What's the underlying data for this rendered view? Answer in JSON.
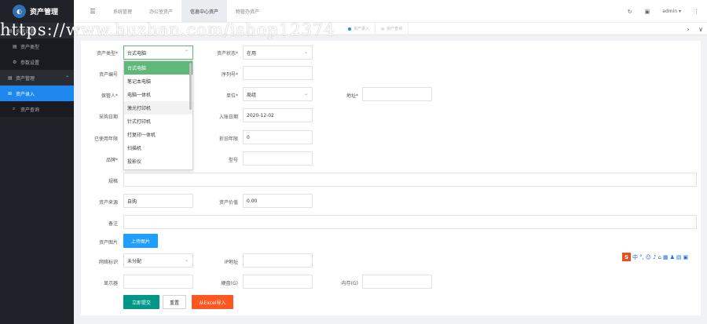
{
  "app": {
    "title": "资产管理"
  },
  "sidebar": {
    "items": [
      {
        "label": "系统设置",
        "icon": "grid-icon",
        "kind": "group"
      },
      {
        "label": "资产类型",
        "icon": "grid-icon",
        "kind": "sub"
      },
      {
        "label": "参数设置",
        "icon": "gear-icon",
        "kind": "sub"
      },
      {
        "label": "资产管理",
        "icon": "grid-icon",
        "kind": "group"
      },
      {
        "label": "资产录入",
        "icon": "plus-square-icon",
        "kind": "active"
      },
      {
        "label": "资产查询",
        "icon": "search-icon",
        "kind": "sub"
      }
    ]
  },
  "header": {
    "menu_icon": "☰",
    "nav": [
      "系统管理",
      "办公室资产",
      "信息中心资产",
      "物管办资产"
    ],
    "active_nav": 2,
    "refresh_icon": "↻",
    "theme_icon": "▣",
    "user": "admin ▾",
    "more_icon": "⋮"
  },
  "tabbar": {
    "tabs": [
      "资产录入",
      "资产查询"
    ],
    "nav_right": "›",
    "nav_down": "∨"
  },
  "watermark": "https://www.huzhan.com/ishop12374",
  "form": {
    "asset_type": {
      "label": "资产类型*",
      "value": "台式电脑"
    },
    "asset_status": {
      "label": "资产状态*",
      "value": "在用"
    },
    "asset_no": {
      "label": "资产编号"
    },
    "serial_no": {
      "label": "序列号*"
    },
    "keeper": {
      "label": "保管人*"
    },
    "unit": {
      "label": "单位*",
      "value": "局组"
    },
    "location": {
      "label": "地址*"
    },
    "purchase_date": {
      "label": "采购日期"
    },
    "entry_date": {
      "label": "入账日期",
      "value": "2020-12-02"
    },
    "service_years": {
      "label": "已使用年限"
    },
    "depreciation_years": {
      "label": "折旧年限",
      "value": "0"
    },
    "brand": {
      "label": "品牌*"
    },
    "model": {
      "label": "型号"
    },
    "spec": {
      "label": "规格"
    },
    "source": {
      "label": "资产来源",
      "value": "自购"
    },
    "value": {
      "label": "资产价值",
      "value": "0.00"
    },
    "remark": {
      "label": "备注"
    },
    "image": {
      "label": "资产图片",
      "button": "上传图片"
    },
    "network": {
      "label": "网络标识",
      "value": "未分配"
    },
    "ip": {
      "label": "IP地址"
    },
    "monitor": {
      "label": "显示器"
    },
    "disk": {
      "label": "硬盘(G)"
    },
    "memory": {
      "label": "内存(G)"
    },
    "submit": "立即提交",
    "reset": "重置",
    "import": "从Excel导入"
  },
  "dropdown": {
    "options": [
      "台式电脑",
      "笔记本电脑",
      "电脑一体机",
      "激光打印机",
      "针式打印机",
      "打复印一体机",
      "扫描机",
      "投影仪"
    ],
    "selected": 0,
    "hovered": 3
  },
  "ime": {
    "brand": "S",
    "items": [
      "中",
      "°,",
      "☺",
      "♪",
      "⌂",
      "▦",
      "♟",
      "▤",
      "▣"
    ]
  },
  "colors": {
    "sidebar_bg": "#20222a",
    "active": "#1e87f0",
    "submit": "#009688",
    "import": "#ff5722",
    "upload": "#1e9fff",
    "selected_option": "#5fb878"
  }
}
